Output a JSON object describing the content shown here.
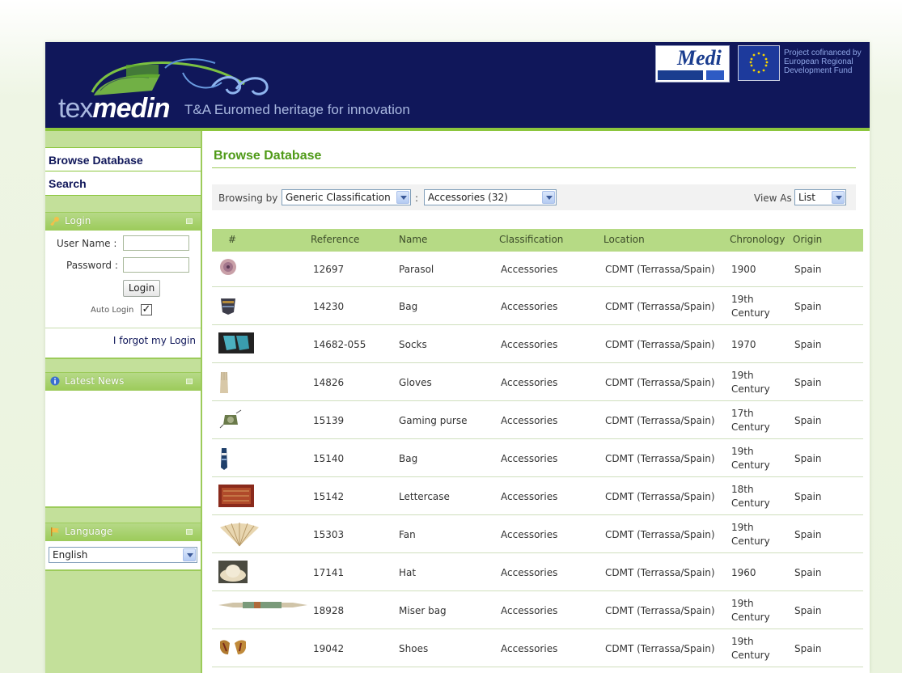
{
  "header": {
    "logo_light": "tex",
    "logo_bold": "medin",
    "tagline": "T&A Euromed heritage for innovation",
    "partner_logo": "Medi",
    "eu_text": "Project cofinanced by European Regional Development Fund"
  },
  "sidebar": {
    "nav": [
      {
        "label": "Browse Database"
      },
      {
        "label": "Search"
      }
    ],
    "login": {
      "title": "Login",
      "username_label": "User Name :",
      "password_label": "Password :",
      "button": "Login",
      "auto_login_label": "Auto Login",
      "auto_login_checked": true,
      "forgot_link": "I forgot my Login"
    },
    "news": {
      "title": "Latest News"
    },
    "language": {
      "title": "Language",
      "selected": "English"
    }
  },
  "main": {
    "title": "Browse Database",
    "browse": {
      "browsing_by_label": "Browsing by",
      "classification_select": "Generic Classification",
      "separator": ":",
      "category_select": "Accessories (32)",
      "view_as_label": "View As",
      "view_select": "List"
    },
    "table": {
      "headers": [
        "#",
        "Reference",
        "Name",
        "Classification",
        "Location",
        "Chronology",
        "Origin"
      ],
      "rows": [
        {
          "thumb": "parasol",
          "reference": "12697",
          "name": "Parasol",
          "classification": "Accessories",
          "location": "CDMT (Terrassa/Spain)",
          "chronology_1": "1900",
          "chronology_2": "",
          "origin": "Spain"
        },
        {
          "thumb": "bag-dark",
          "reference": "14230",
          "name": "Bag",
          "classification": "Accessories",
          "location": "CDMT (Terrassa/Spain)",
          "chronology_1": "19th",
          "chronology_2": "Century",
          "origin": "Spain"
        },
        {
          "thumb": "socks",
          "reference": "14682-055",
          "name": "Socks",
          "classification": "Accessories",
          "location": "CDMT (Terrassa/Spain)",
          "chronology_1": "1970",
          "chronology_2": "",
          "origin": "Spain"
        },
        {
          "thumb": "gloves",
          "reference": "14826",
          "name": "Gloves",
          "classification": "Accessories",
          "location": "CDMT (Terrassa/Spain)",
          "chronology_1": "19th",
          "chronology_2": "Century",
          "origin": "Spain"
        },
        {
          "thumb": "gaming-purse",
          "reference": "15139",
          "name": "Gaming purse",
          "classification": "Accessories",
          "location": "CDMT (Terrassa/Spain)",
          "chronology_1": "17th",
          "chronology_2": "Century",
          "origin": "Spain"
        },
        {
          "thumb": "bag-blue",
          "reference": "15140",
          "name": "Bag",
          "classification": "Accessories",
          "location": "CDMT (Terrassa/Spain)",
          "chronology_1": "19th",
          "chronology_2": "Century",
          "origin": "Spain"
        },
        {
          "thumb": "lettercase",
          "reference": "15142",
          "name": "Lettercase",
          "classification": "Accessories",
          "location": "CDMT (Terrassa/Spain)",
          "chronology_1": "18th",
          "chronology_2": "Century",
          "origin": "Spain"
        },
        {
          "thumb": "fan",
          "reference": "15303",
          "name": "Fan",
          "classification": "Accessories",
          "location": "CDMT (Terrassa/Spain)",
          "chronology_1": "19th",
          "chronology_2": "Century",
          "origin": "Spain"
        },
        {
          "thumb": "hat",
          "reference": "17141",
          "name": "Hat",
          "classification": "Accessories",
          "location": "CDMT (Terrassa/Spain)",
          "chronology_1": "1960",
          "chronology_2": "",
          "origin": "Spain"
        },
        {
          "thumb": "miser-bag",
          "reference": "18928",
          "name": "Miser bag",
          "classification": "Accessories",
          "location": "CDMT (Terrassa/Spain)",
          "chronology_1": "19th",
          "chronology_2": "Century",
          "origin": "Spain"
        },
        {
          "thumb": "shoes",
          "reference": "19042",
          "name": "Shoes",
          "classification": "Accessories",
          "location": "CDMT (Terrassa/Spain)",
          "chronology_1": "19th",
          "chronology_2": "Century",
          "origin": "Spain"
        }
      ]
    }
  },
  "colors": {
    "header_bg": "#10175a",
    "accent_green": "#8cc63e",
    "title_green": "#4f9a18",
    "table_header": "#b6da85",
    "link": "#10175a"
  }
}
